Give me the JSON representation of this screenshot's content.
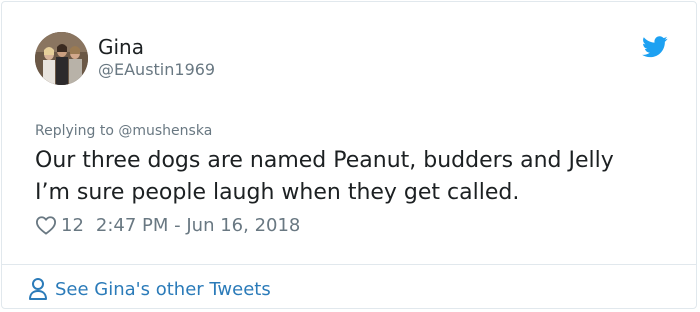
{
  "user": {
    "name": "Gina",
    "handle": "@EAustin1969"
  },
  "reply": {
    "text": "Replying to @mushenska"
  },
  "tweet": {
    "lines": [
      "Our three dogs are named Peanut, budders and Jelly",
      "I’m sure people laugh when they get called."
    ]
  },
  "meta": {
    "likes": "12",
    "timestamp": "2:47 PM - Jun 16, 2018"
  },
  "footer": {
    "see_more": "See Gina's other Tweets"
  },
  "icons": {
    "brand": "twitter-bird-icon",
    "like": "heart-icon",
    "profile": "person-icon"
  },
  "colors": {
    "brand": "#1da1f2",
    "link": "#2b7bb9",
    "muted": "#697882",
    "text": "#1c2022",
    "border": "#e1e8ed"
  }
}
